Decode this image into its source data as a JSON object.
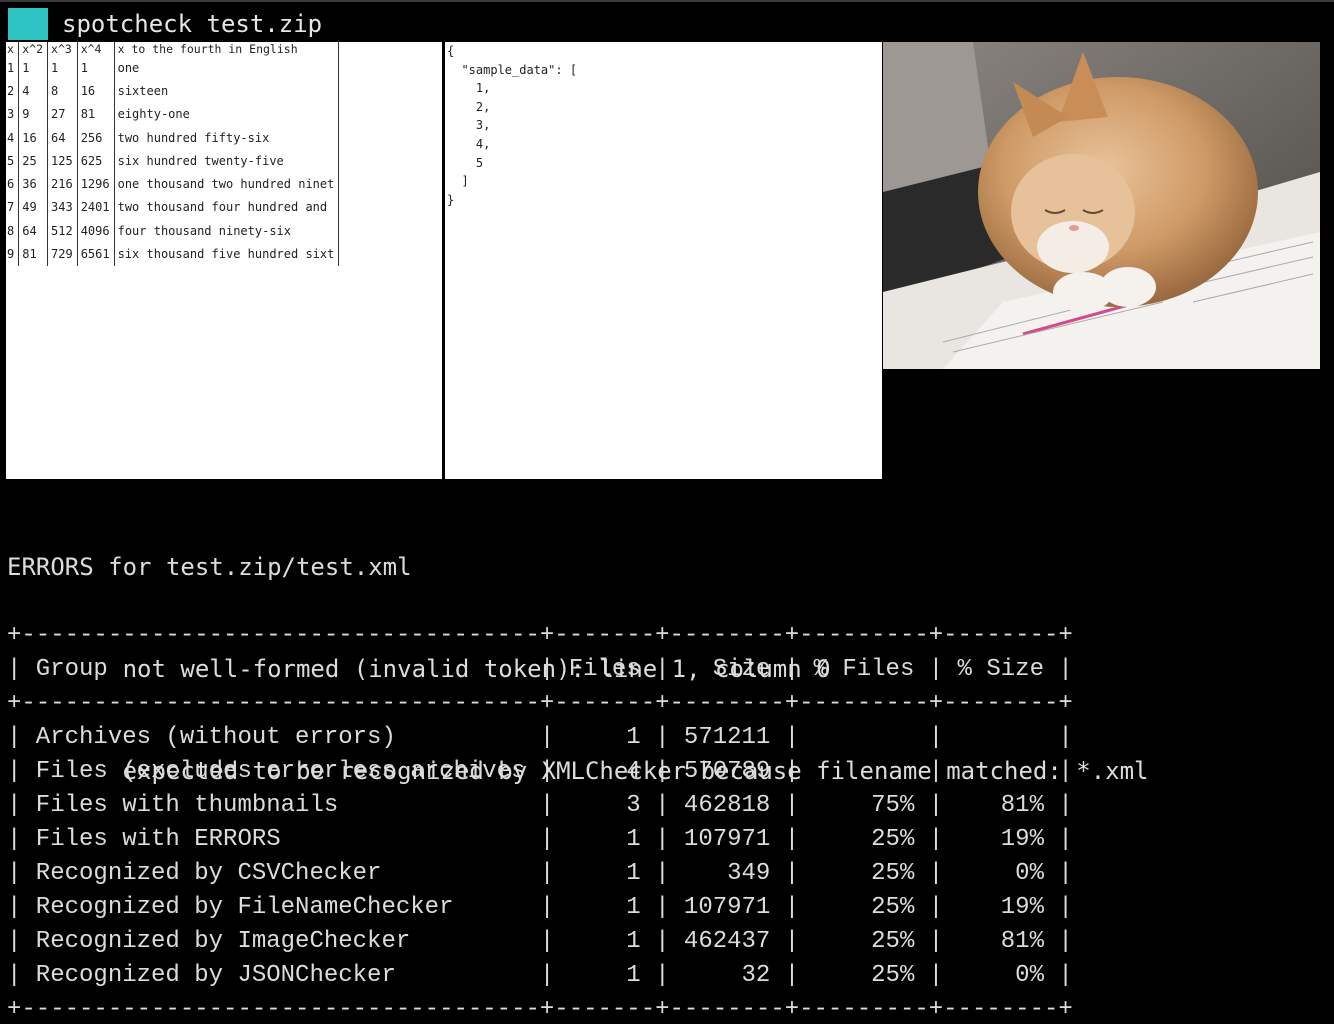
{
  "window": {
    "title": "spotcheck test.zip"
  },
  "csv_thumbnail": {
    "header": [
      "x",
      "x^2",
      "x^3",
      "x^4",
      "x to the fourth in English"
    ],
    "rows": [
      [
        "1",
        "1",
        "1",
        "1",
        "one"
      ],
      [
        "2",
        "4",
        "8",
        "16",
        "sixteen"
      ],
      [
        "3",
        "9",
        "27",
        "81",
        "eighty-one"
      ],
      [
        "4",
        "16",
        "64",
        "256",
        "two hundred fifty-six"
      ],
      [
        "5",
        "25",
        "125",
        "625",
        "six hundred twenty-five"
      ],
      [
        "6",
        "36",
        "216",
        "1296",
        "one thousand two hundred ninet"
      ],
      [
        "7",
        "49",
        "343",
        "2401",
        "two thousand four hundred and"
      ],
      [
        "8",
        "64",
        "512",
        "4096",
        "four thousand ninety-six"
      ],
      [
        "9",
        "81",
        "729",
        "6561",
        "six thousand five hundred sixt"
      ]
    ]
  },
  "json_thumbnail": {
    "text": "{\n  \"sample_data\": [\n    1,\n    2,\n    3,\n    4,\n    5\n  ]\n}"
  },
  "image_thumbnail": {
    "subject": "cat"
  },
  "errors": {
    "heading": "ERRORS for test.zip/test.xml",
    "lines": [
      "not well-formed (invalid token): line 1, column 0",
      "expected to be recognized by XMLChecker because filename matched: *.xml"
    ]
  },
  "stats": {
    "columns": [
      "Group",
      "Files",
      "Size",
      "% Files",
      "% Size"
    ],
    "rows": [
      [
        "Archives (without errors)",
        "1",
        "571211",
        "",
        ""
      ],
      [
        "Files (excludes errorless archives)",
        "4",
        "570789",
        "",
        ""
      ],
      [
        "Files with thumbnails",
        "3",
        "462818",
        "75%",
        "81%"
      ],
      [
        "Files with ERRORS",
        "1",
        "107971",
        "25%",
        "19%"
      ],
      [
        "Recognized by CSVChecker",
        "1",
        "349",
        "25%",
        "0%"
      ],
      [
        "Recognized by FileNameChecker",
        "1",
        "107971",
        "25%",
        "19%"
      ],
      [
        "Recognized by ImageChecker",
        "1",
        "462437",
        "25%",
        "81%"
      ],
      [
        "Recognized by JSONChecker",
        "1",
        "32",
        "25%",
        "0%"
      ]
    ]
  },
  "colors": {
    "cursor": "#2ec4c4",
    "background": "#000000",
    "text": "#dcdcdc"
  }
}
